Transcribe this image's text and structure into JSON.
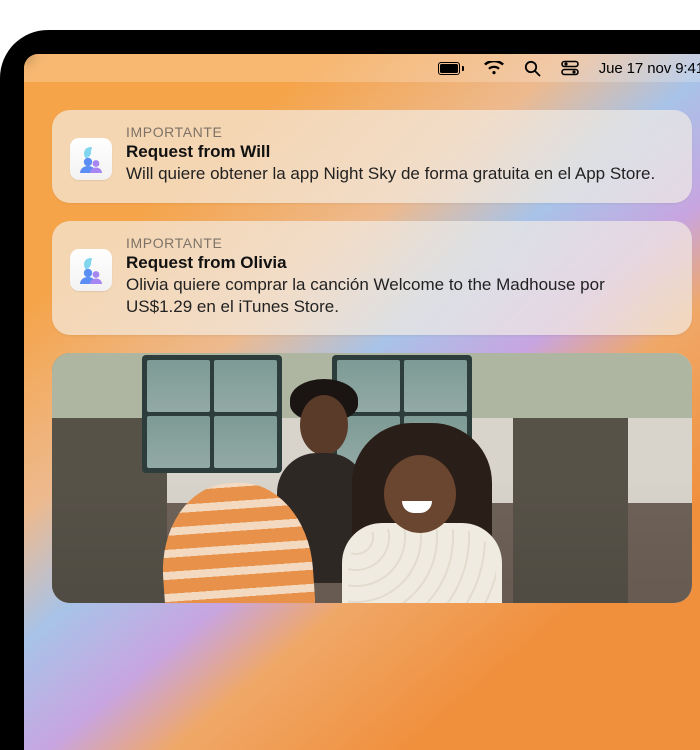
{
  "menubar": {
    "datetime": "Jue 17 nov 9:41"
  },
  "notifications": [
    {
      "label": "IMPORTANTE",
      "title": "Request from Will",
      "message": "Will quiere obtener la app Night Sky de forma gratuita en el App Store.",
      "icon": "family-sharing-icon"
    },
    {
      "label": "IMPORTANTE",
      "title": "Request from Olivia",
      "message": "Olivia quiere comprar la canción Welcome to the Madhouse por US$1.29 en el iTunes Store.",
      "icon": "family-sharing-icon"
    }
  ]
}
